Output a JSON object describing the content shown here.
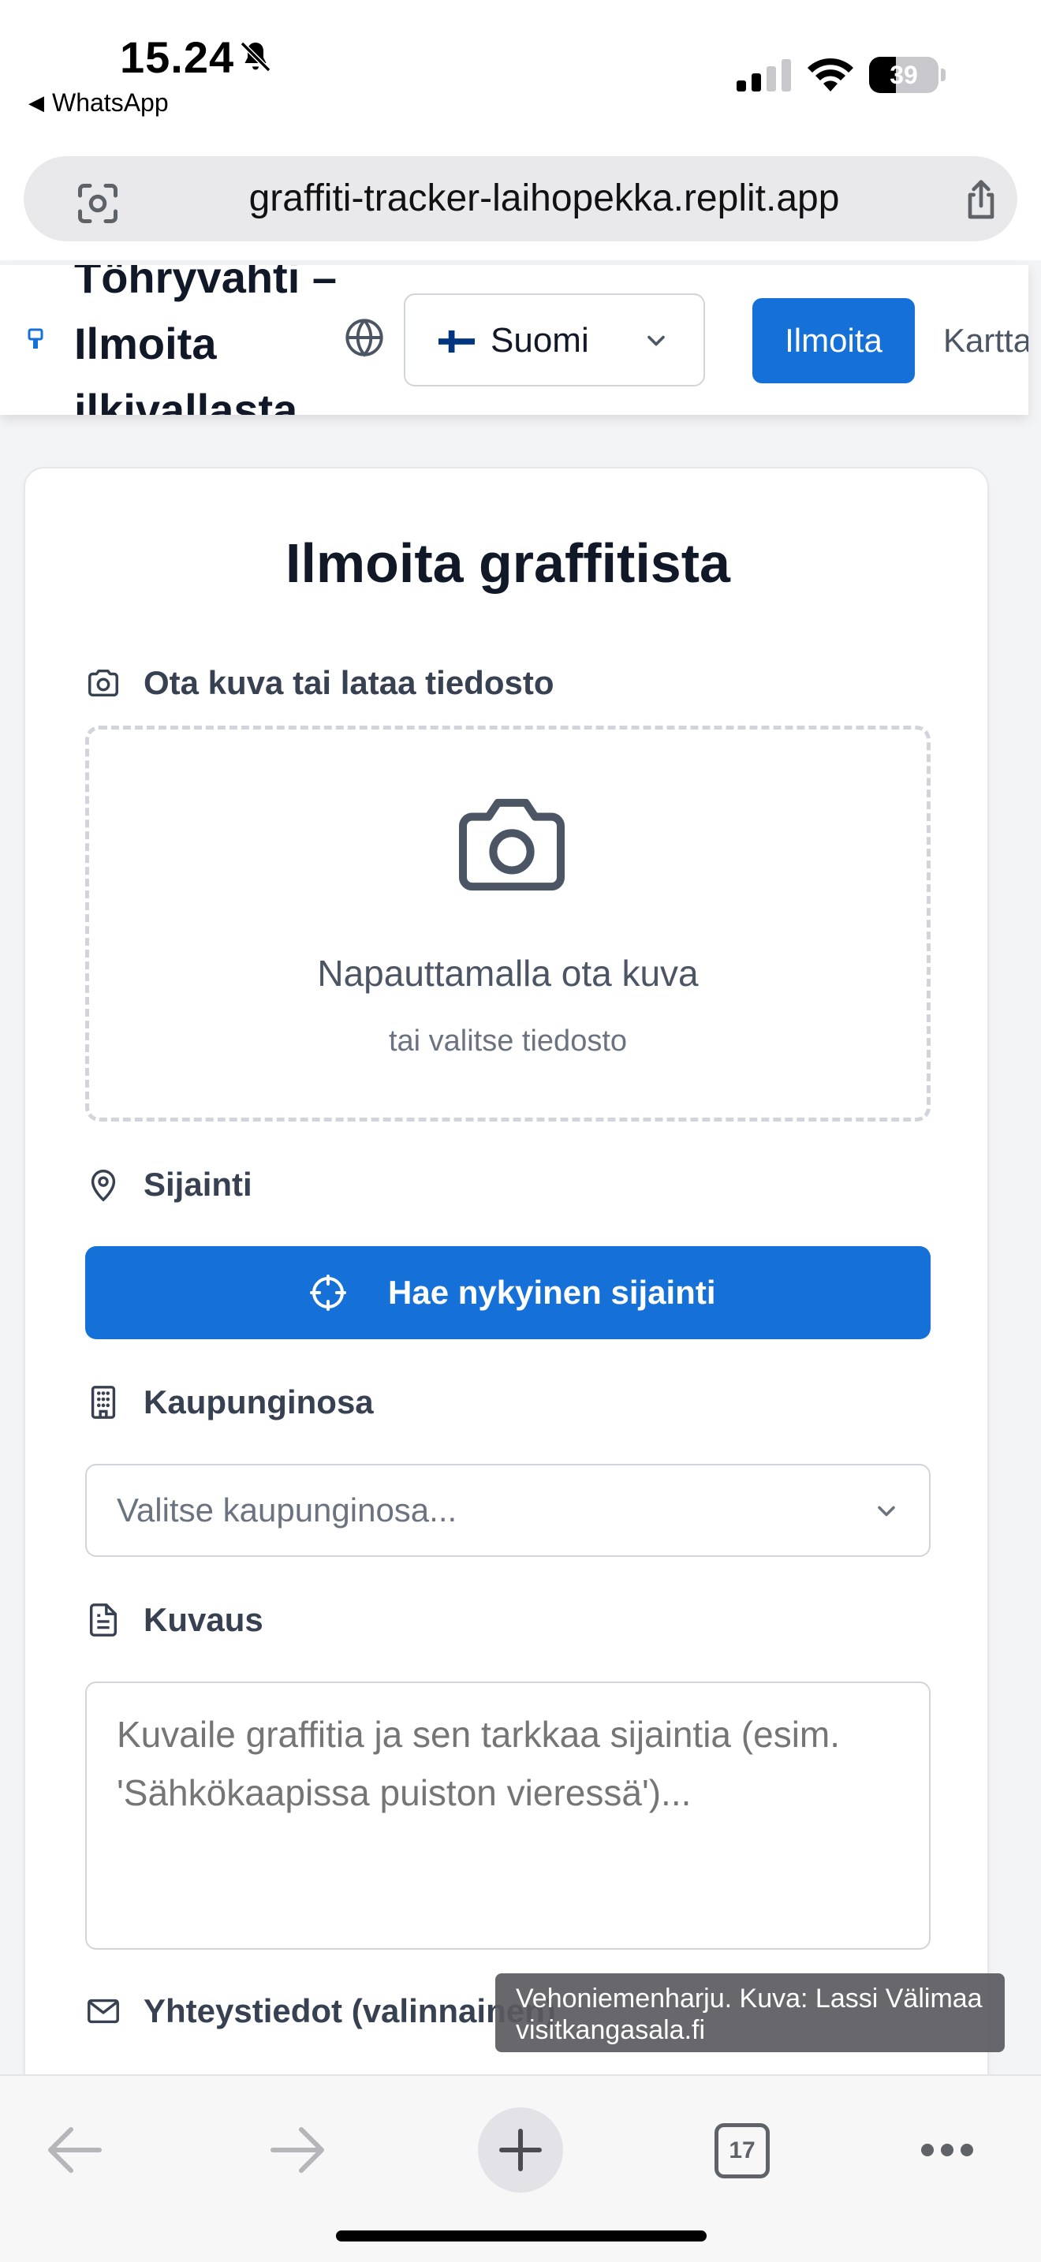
{
  "status_bar": {
    "time": "15.24",
    "back_app": "WhatsApp",
    "battery_percent": 39,
    "battery_label": "39",
    "icons": [
      "bell-slash-icon",
      "signal-icon",
      "wifi-icon",
      "battery-icon"
    ]
  },
  "browser": {
    "url": "graffiti-tracker-laihopekka.replit.app",
    "tab_count": "17",
    "icons": [
      "lens-icon",
      "share-icon",
      "back-arrow-icon",
      "forward-arrow-icon",
      "plus-icon",
      "tabs-icon",
      "more-icon"
    ]
  },
  "header": {
    "title": "Töhryvahti – Ilmoita ilkivallasta",
    "language": "Suomi",
    "nav": {
      "report": "Ilmoita",
      "map": "Kartta"
    },
    "colors": {
      "primary": "#1570d8"
    }
  },
  "form": {
    "title": "Ilmoita graffitista",
    "photo": {
      "label": "Ota kuva tai lataa tiedosto",
      "primary": "Napauttamalla ota kuva",
      "secondary": "tai valitse tiedosto"
    },
    "location": {
      "label": "Sijainti",
      "button": "Hae nykyinen sijainti"
    },
    "district": {
      "label": "Kaupunginosa",
      "placeholder": "Valitse kaupunginosa..."
    },
    "description": {
      "label": "Kuvaus",
      "placeholder": "Kuvaile graffitia ja sen tarkkaa sijaintia (esim. 'Sähkökaapissa puiston vieressä')..."
    },
    "contact": {
      "label": "Yhteystiedot (valinnainen)"
    }
  },
  "overlay": {
    "line1": "Vehoniemenharju. Kuva: Lassi Välimaa",
    "line2": "visitkangasala.fi"
  }
}
